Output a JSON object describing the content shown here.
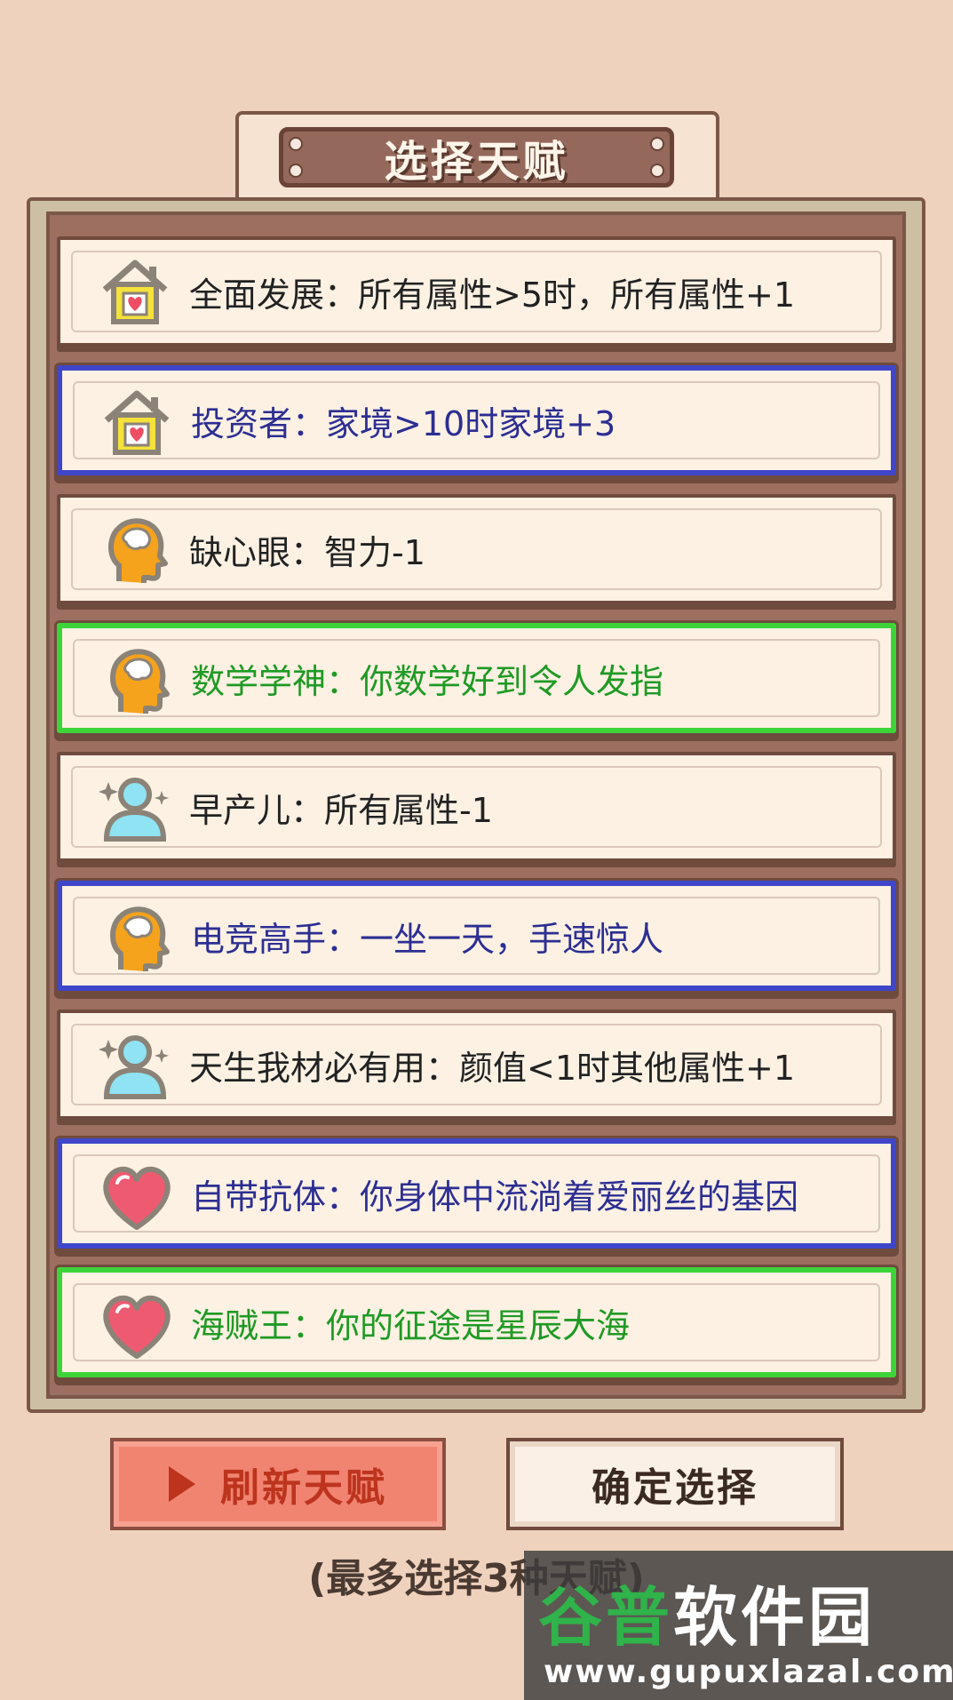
{
  "title": "选择天赋",
  "talents": [
    {
      "icon": "house-icon",
      "rarity": "common",
      "text": "全面发展：所有属性>5时，所有属性+1"
    },
    {
      "icon": "house-icon",
      "rarity": "rare",
      "text": "投资者：家境>10时家境+3"
    },
    {
      "icon": "brain-head-icon",
      "rarity": "common",
      "text": "缺心眼：智力-1"
    },
    {
      "icon": "brain-head-icon",
      "rarity": "epic",
      "text": "数学学神：你数学好到令人发指"
    },
    {
      "icon": "person-sparkle-icon",
      "rarity": "common",
      "text": "早产儿：所有属性-1"
    },
    {
      "icon": "brain-head-icon",
      "rarity": "rare",
      "text": "电竞高手：一坐一天，手速惊人"
    },
    {
      "icon": "person-sparkle-icon",
      "rarity": "common",
      "text": "天生我材必有用：颜值<1时其他属性+1"
    },
    {
      "icon": "heart-icon",
      "rarity": "rare",
      "text": "自带抗体：你身体中流淌着爱丽丝的基因"
    },
    {
      "icon": "heart-icon",
      "rarity": "epic",
      "text": "海贼王：你的征途是星辰大海"
    }
  ],
  "buttons": {
    "refresh": "刷新天赋",
    "confirm": "确定选择"
  },
  "hint": "(最多选择3种天赋)",
  "watermark": {
    "logo_g": "谷普",
    "logo_rest": "软件园",
    "url": "www.gupuxlazal.com"
  },
  "colors": {
    "rare": "#3f46c9",
    "epic": "#3dd43a",
    "common": "#6f4b3d"
  }
}
